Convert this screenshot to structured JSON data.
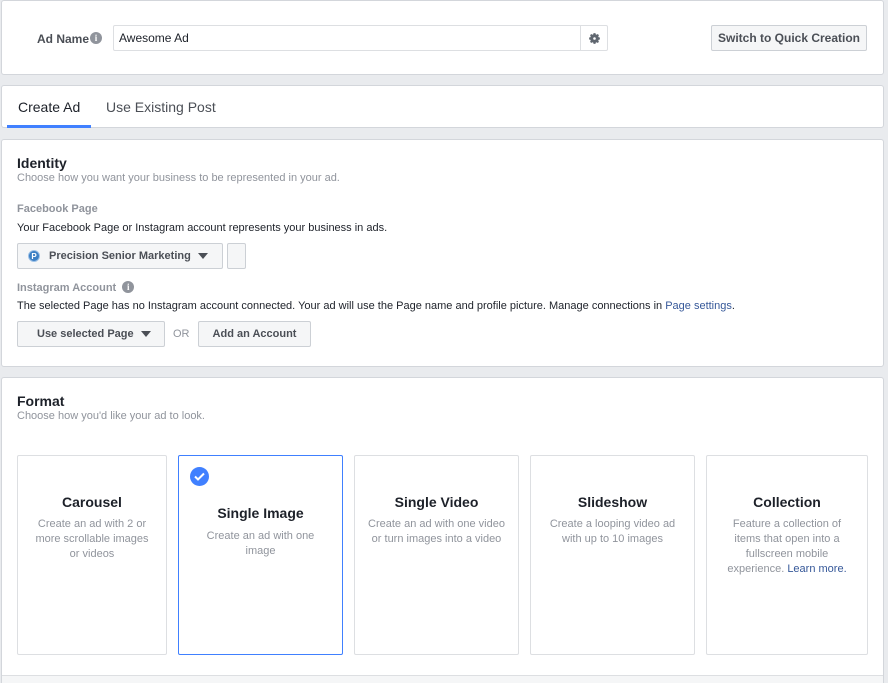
{
  "ad_name": {
    "label": "Ad Name",
    "value": "Awesome Ad",
    "info_icon": "info-icon",
    "settings_icon": "gear-icon",
    "quick_creation_label": "Switch to Quick Creation"
  },
  "tabs": [
    {
      "label": "Create Ad",
      "active": true
    },
    {
      "label": "Use Existing Post",
      "active": false
    }
  ],
  "identity": {
    "title": "Identity",
    "subtitle": "Choose how you want your business to be represented in your ad.",
    "facebook_page": {
      "label": "Facebook Page",
      "description": "Your Facebook Page or Instagram account represents your business in ads.",
      "selected": "Precision Senior Marketing",
      "avatar_letter": "P"
    },
    "instagram": {
      "label": "Instagram Account",
      "description": "The selected Page has no Instagram account connected. Your ad will use the Page name and profile picture. Manage connections in ",
      "link": "Page settings",
      "link_suffix": ".",
      "use_page_label": "Use selected Page",
      "or_text": "OR",
      "add_account_label": "Add an Account"
    }
  },
  "format": {
    "title": "Format",
    "subtitle": "Choose how you'd like your ad to look.",
    "options": [
      {
        "title": "Carousel",
        "description": "Create an ad with 2 or more scrollable images or videos",
        "selected": false
      },
      {
        "title": "Single Image",
        "description": "Create an ad with one image",
        "selected": true
      },
      {
        "title": "Single Video",
        "description": "Create an ad with one video or turn images into a video",
        "selected": false
      },
      {
        "title": "Slideshow",
        "description": "Create a looping video ad with up to 10 images",
        "selected": false
      },
      {
        "title": "Collection",
        "description": "Feature a collection of items that open into a fullscreen mobile experience. ",
        "link": "Learn more.",
        "selected": false
      }
    ]
  },
  "colors": {
    "accent": "#4080ff",
    "link": "#365899",
    "background": "#e9ebee"
  }
}
